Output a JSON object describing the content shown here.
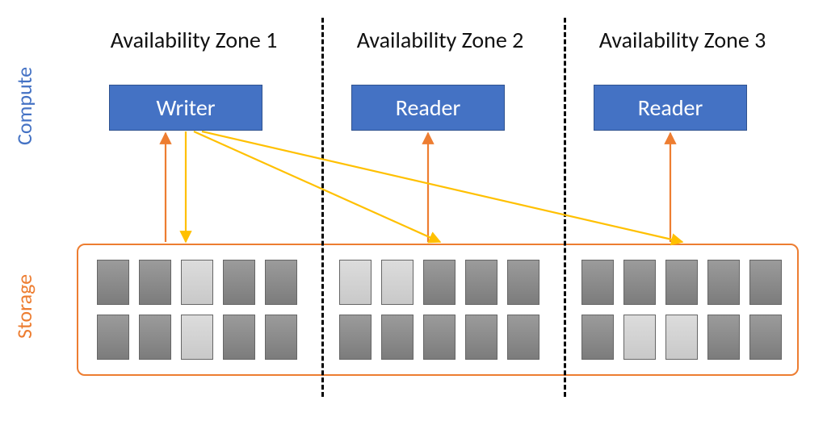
{
  "rowLabels": {
    "compute": {
      "text": "Compute",
      "color": "#4472C4"
    },
    "storage": {
      "text": "Storage",
      "color": "#ED7D31"
    }
  },
  "zones": [
    {
      "header": "Availability Zone 1",
      "node": "Writer",
      "blocks": [
        "dark",
        "dark",
        "light",
        "dark",
        "dark",
        "dark",
        "dark",
        "light",
        "dark",
        "dark"
      ]
    },
    {
      "header": "Availability Zone 2",
      "node": "Reader",
      "blocks": [
        "light",
        "light",
        "dark",
        "dark",
        "dark",
        "dark",
        "dark",
        "dark",
        "dark",
        "dark"
      ]
    },
    {
      "header": "Availability Zone 3",
      "node": "Reader",
      "blocks": [
        "dark",
        "dark",
        "dark",
        "dark",
        "dark",
        "dark",
        "light",
        "light",
        "dark",
        "dark"
      ]
    }
  ],
  "colors": {
    "nodeFill": "#4472C4",
    "storageBorder": "#ED7D31",
    "orangeArrow": "#ED7D31",
    "yellowArrow": "#FFC000"
  },
  "arrows": {
    "description": "Writer writes to storage in all three AZs (yellow). Each compute node reads from its local storage copy (orange).",
    "reads": [
      {
        "from": "Storage AZ1",
        "to": "Writer",
        "color": "orange"
      },
      {
        "from": "Storage AZ2",
        "to": "Reader2",
        "color": "orange"
      },
      {
        "from": "Storage AZ3",
        "to": "Reader3",
        "color": "orange"
      }
    ],
    "writes": [
      {
        "from": "Writer",
        "to": "Storage AZ1",
        "color": "yellow"
      },
      {
        "from": "Writer",
        "to": "Storage AZ2",
        "color": "yellow"
      },
      {
        "from": "Writer",
        "to": "Storage AZ3",
        "color": "yellow"
      }
    ]
  }
}
